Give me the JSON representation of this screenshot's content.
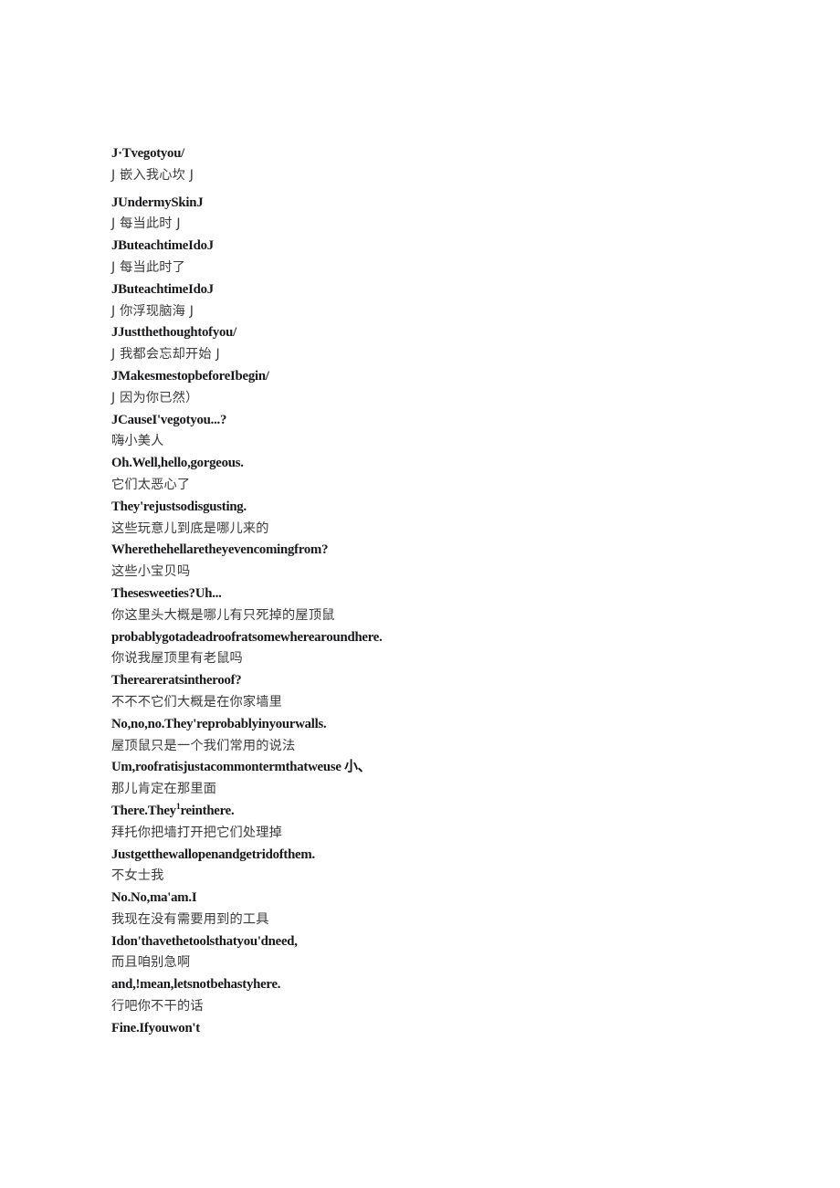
{
  "document": {
    "background_color": "#ffffff",
    "text_color_latin": "#18181a",
    "text_color_cjk": "#3b3b3d",
    "lines": [
      {
        "text": "J·Tvegotyou/",
        "lang": "en"
      },
      {
        "text": "J 嵌入我心坎 J",
        "lang": "zh",
        "gap_after": true
      },
      {
        "text": "JUndermySkinJ",
        "lang": "en"
      },
      {
        "text": "J 每当此时 J",
        "lang": "zh"
      },
      {
        "text": "JButeachtimeIdoJ",
        "lang": "en"
      },
      {
        "text": "J 每当此时了",
        "lang": "zh"
      },
      {
        "text": "JButeachtimeIdoJ",
        "lang": "en"
      },
      {
        "text": "J 你浮现脑海 J",
        "lang": "zh"
      },
      {
        "text": "JJustthethoughtofyou/",
        "lang": "en"
      },
      {
        "text": "J 我都会忘却开始 J",
        "lang": "zh"
      },
      {
        "text": "JMakesmestopbeforeIbegin/",
        "lang": "en"
      },
      {
        "text": "J 因为你已然）",
        "lang": "zh"
      },
      {
        "text": "JCauseI'vegotyou...?",
        "lang": "en"
      },
      {
        "text": "嗨小美人",
        "lang": "zh"
      },
      {
        "text": "Oh.Well,hello,gorgeous.",
        "lang": "en"
      },
      {
        "text": "它们太恶心了",
        "lang": "zh"
      },
      {
        "text": "They'rejustsodisgusting.",
        "lang": "en"
      },
      {
        "text": "这些玩意儿到底是哪儿来的",
        "lang": "zh"
      },
      {
        "text": "Wherethehellaretheyevencomingfrom?",
        "lang": "en"
      },
      {
        "text": "这些小宝贝吗",
        "lang": "zh"
      },
      {
        "text": "Thesesweeties?Uh...",
        "lang": "en"
      },
      {
        "text": "你这里头大概是哪儿有只死掉的屋顶鼠",
        "lang": "zh"
      },
      {
        "text": "probablygotadeadroofratsomewherearoundhere.",
        "lang": "en"
      },
      {
        "text": "你说我屋顶里有老鼠吗",
        "lang": "zh"
      },
      {
        "text": "Thereareratsintheroof?",
        "lang": "en"
      },
      {
        "text": "不不不它们大概是在你家墙里",
        "lang": "zh"
      },
      {
        "text": "No,no,no.They'reprobablyinyourwalls.",
        "lang": "en"
      },
      {
        "text": "屋顶鼠只是一个我们常用的说法",
        "lang": "zh"
      },
      {
        "text": "Um,roofratisjustacommontermthatweuse 小、",
        "lang": "en"
      },
      {
        "text": "那儿肯定在那里面",
        "lang": "zh"
      },
      {
        "text": "There.They",
        "suffix_sup": "1",
        "suffix": "reinthere.",
        "lang": "en"
      },
      {
        "text": "拜托你把墙打开把它们处理掉",
        "lang": "zh"
      },
      {
        "text": "Justgetthewallopenandgetridofthem.",
        "lang": "en"
      },
      {
        "text": "不女士我",
        "lang": "zh"
      },
      {
        "text": "No.No,ma'am.I",
        "lang": "en"
      },
      {
        "text": "我现在没有需要用到的工具",
        "lang": "zh"
      },
      {
        "text": "Idon'thavethetoolsthatyou'dneed,",
        "lang": "en"
      },
      {
        "text": "而且咱别急啊",
        "lang": "zh"
      },
      {
        "text": "and,!mean,letsnotbehastyhere.",
        "lang": "en"
      },
      {
        "text": "行吧你不干的话",
        "lang": "zh"
      },
      {
        "text": "Fine.Ifyouwon't",
        "lang": "en"
      }
    ]
  }
}
